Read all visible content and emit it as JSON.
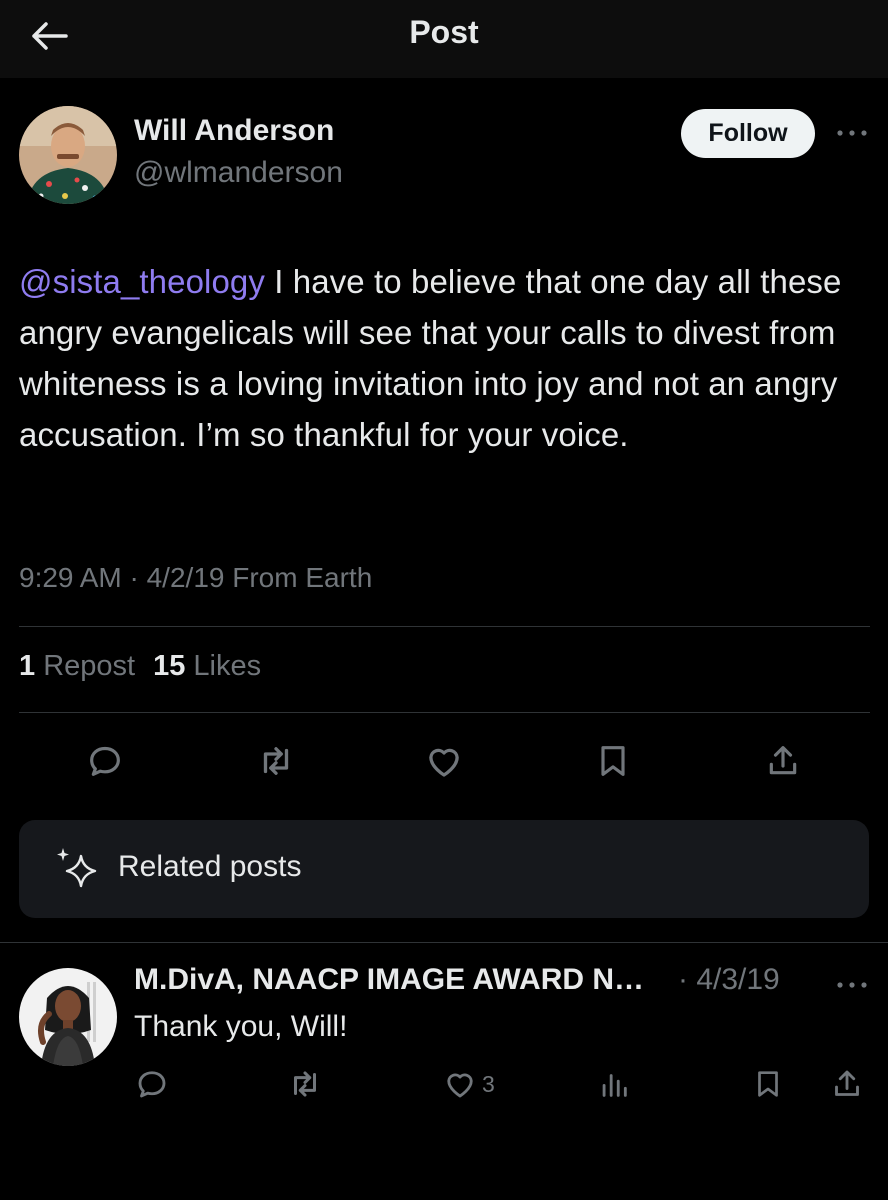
{
  "header": {
    "title": "Post",
    "back_icon": "arrow-left-icon"
  },
  "post": {
    "author_name": "Will Anderson",
    "author_handle": "@wlmanderson",
    "follow_label": "Follow",
    "more_icon": "more-horizontal-icon",
    "mention": "@sista_theology",
    "body_rest": " I have to believe that one day all these angry evangelicals will see that your calls to divest from whiteness is a loving invitation into joy and not an angry accusation. I’m so thankful for your voice.",
    "timestamp": "9:29 AM · 4/2/19 From Earth",
    "repost_count": "1",
    "repost_label": "Repost",
    "like_count": "15",
    "like_label": "Likes",
    "actions": [
      "reply-icon",
      "repost-icon",
      "like-icon",
      "bookmark-icon",
      "share-icon"
    ]
  },
  "related": {
    "label": "Related posts",
    "icon": "sparkle-icon"
  },
  "reply": {
    "author_name": "M.DivA, NAACP IMAGE AWARD N…",
    "date": "· 4/3/19",
    "text": "Thank you, Will!",
    "like_count": "3",
    "actions": [
      "reply-icon",
      "repost-icon",
      "like-icon",
      "views-icon",
      "bookmark-icon",
      "share-icon"
    ]
  },
  "colors": {
    "background": "#000000",
    "text_primary": "#e7e9ea",
    "text_secondary": "#71767b",
    "mention": "#8f7cf0",
    "follow_bg": "#eff3f4",
    "card_bg": "#16181c",
    "divider": "#2f3336"
  }
}
